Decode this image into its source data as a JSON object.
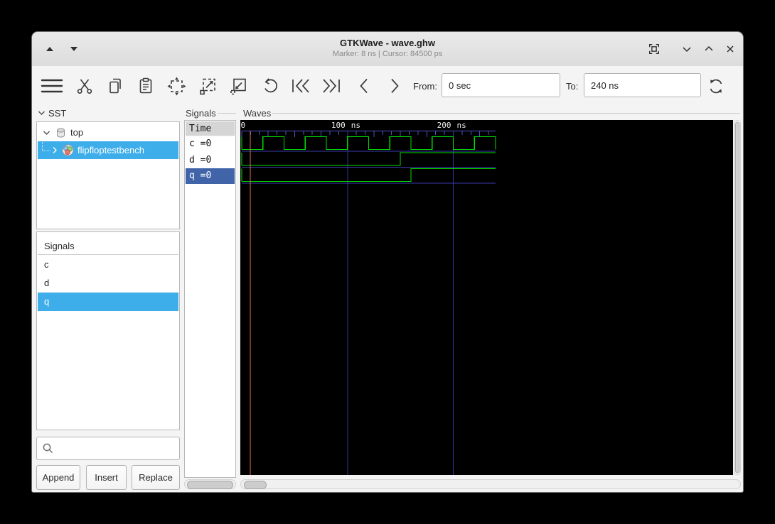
{
  "titlebar": {
    "title": "GTKWave - wave.ghw",
    "status": "Marker: 8 ns  |  Cursor: 84500 ps"
  },
  "toolbar": {
    "from_label": "From:",
    "from_value": "0 sec",
    "to_label": "To:",
    "to_value": "240 ns"
  },
  "sst": {
    "label": "SST",
    "root": "top",
    "child": "flipfloptestbench"
  },
  "signal_list": {
    "header": "Signals",
    "items": [
      "c",
      "d",
      "q"
    ]
  },
  "search": {
    "value": ""
  },
  "actions": {
    "append": "Append",
    "insert": "Insert",
    "replace": "Replace"
  },
  "names": {
    "frame_label": "Signals",
    "time_header": "Time",
    "rows": [
      "c =0",
      "d =0",
      "q =0"
    ]
  },
  "waves": {
    "frame_label": "Waves",
    "range_ns": [
      0,
      240
    ],
    "marker_ns": 8,
    "timeline": {
      "zero_label": "0",
      "unit": "ns",
      "marks": [
        {
          "t": 100,
          "label": "100"
        },
        {
          "t": 200,
          "label": "200"
        }
      ]
    },
    "signals": [
      {
        "name": "c",
        "transitions": [
          [
            0,
            0
          ],
          [
            20,
            1
          ],
          [
            40,
            0
          ],
          [
            60,
            1
          ],
          [
            80,
            0
          ],
          [
            100,
            1
          ],
          [
            120,
            0
          ],
          [
            140,
            1
          ],
          [
            160,
            0
          ],
          [
            180,
            1
          ],
          [
            200,
            0
          ],
          [
            220,
            1
          ],
          [
            240,
            0
          ]
        ]
      },
      {
        "name": "d",
        "transitions": [
          [
            0,
            0
          ],
          [
            150,
            1
          ]
        ]
      },
      {
        "name": "q",
        "transitions": [
          [
            0,
            0
          ],
          [
            160,
            1
          ]
        ]
      }
    ],
    "colors": {
      "trace": "#00dc00",
      "separator": "#3c3cae",
      "tick": "#5050c6",
      "grid": "#3434a0",
      "marker": "#df6b5e",
      "background": "#000000",
      "text": "#ededed"
    }
  }
}
